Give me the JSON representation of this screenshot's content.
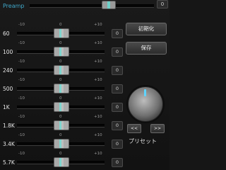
{
  "preamp": {
    "label": "Preamp",
    "value": "0",
    "level": 0.6
  },
  "ticks": {
    "min": "-10",
    "mid": "0",
    "max": "+10"
  },
  "bands": [
    {
      "label": "60",
      "value": "0",
      "level": 0.5
    },
    {
      "label": "100",
      "value": "0",
      "level": 0.5
    },
    {
      "label": "240",
      "value": "0",
      "level": 0.5
    },
    {
      "label": "500",
      "value": "0",
      "level": 0.5
    },
    {
      "label": "1K",
      "value": "0",
      "level": 0.5
    },
    {
      "label": "1.8K",
      "value": "0",
      "level": 0.5
    },
    {
      "label": "3.4K",
      "value": "0",
      "level": 0.5
    },
    {
      "label": "5.7K",
      "value": "0",
      "level": 0.5
    }
  ],
  "buttons": {
    "initialize": "初期化",
    "save": "保存",
    "prev": "<<",
    "next": ">>"
  },
  "preset": {
    "label": "プリセット"
  },
  "colors": {
    "accent": "#3fa7c9",
    "knob_highlight": "#7fd6cf",
    "dial_indicator": "#5fd4ff"
  },
  "icons": {
    "dial": "rotary-knob-icon"
  }
}
